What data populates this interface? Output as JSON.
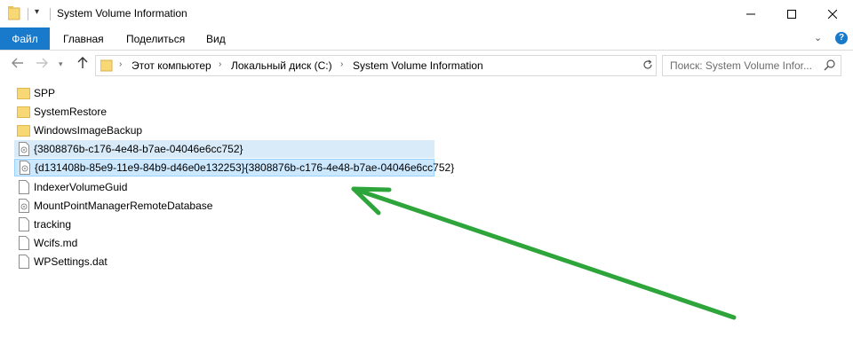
{
  "window": {
    "title": "System Volume Information",
    "controls": {
      "minimize": "—",
      "maximize": "☐",
      "close": "✕"
    }
  },
  "ribbon": {
    "tabs": [
      "Файл",
      "Главная",
      "Поделиться",
      "Вид"
    ],
    "help": "?"
  },
  "nav": {
    "breadcrumbs": [
      "Этот компьютер",
      "Локальный диск (C:)",
      "System Volume Information"
    ],
    "search_placeholder": "Поиск: System Volume Infor..."
  },
  "files": [
    {
      "name": "SPP",
      "type": "folder"
    },
    {
      "name": "SystemRestore",
      "type": "folder"
    },
    {
      "name": "WindowsImageBackup",
      "type": "folder"
    },
    {
      "name": "{3808876b-c176-4e48-b7ae-04046e6cc752}",
      "type": "system-file",
      "state": "highlighted"
    },
    {
      "name": "{d131408b-85e9-11e9-84b9-d46e0e132253}{3808876b-c176-4e48-b7ae-04046e6cc752}",
      "type": "system-file",
      "state": "selected"
    },
    {
      "name": "IndexerVolumeGuid",
      "type": "file"
    },
    {
      "name": "MountPointManagerRemoteDatabase",
      "type": "system-file"
    },
    {
      "name": "tracking",
      "type": "file"
    },
    {
      "name": "Wcifs.md",
      "type": "file"
    },
    {
      "name": "WPSettings.dat",
      "type": "file"
    }
  ],
  "colors": {
    "accent": "#1979ca",
    "selection": "#cce8ff",
    "highlight": "#d9ebf9",
    "folder": "#f8d775",
    "annotation_arrow": "#2ea53a"
  }
}
